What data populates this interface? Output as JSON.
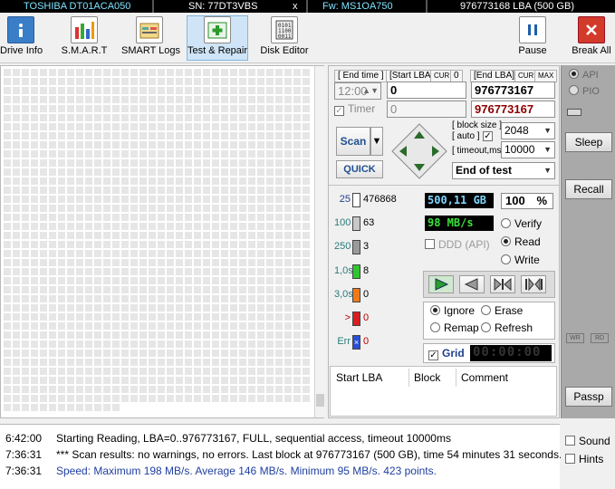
{
  "drive_bar": {
    "model": "TOSHIBA DT01ACA050",
    "serial": "SN: 77DT3VBS",
    "close": "x",
    "firmware": "Fw: MS1OA750",
    "capacity": "976773168 LBA (500 GB)"
  },
  "toolbar": {
    "items": [
      {
        "label": "Drive Info",
        "icon": "info-icon"
      },
      {
        "label": "S.M.A.R.T",
        "icon": "smart-bars-icon"
      },
      {
        "label": "SMART Logs",
        "icon": "logs-icon"
      },
      {
        "label": "Test & Repair",
        "icon": "test-repair-icon"
      },
      {
        "label": "Disk Editor",
        "icon": "disk-editor-icon"
      }
    ],
    "pause_label": "Pause",
    "break_label": "Break All",
    "colors": {
      "accent": "#1e5fa8",
      "break": "#d23a2a"
    }
  },
  "range": {
    "end_time_label": "[ End time ]",
    "start_lba_label": "[Start LBA]",
    "cur_label": "CUR",
    "start_cur_value": "0",
    "end_lba_label": "[End LBA]",
    "max_label": "MAX",
    "end_time_value": "12:00",
    "start_lba_value": "0",
    "end_lba_value": "976773167",
    "timer_label": "Timer",
    "timer_value": "0",
    "end_lba_current": "976773167"
  },
  "scan": {
    "scan_label": "Scan",
    "quick_label": "QUICK",
    "block_size_label": "[ block size ]",
    "auto_label": "[ auto ]",
    "block_size_value": "2048",
    "timeout_label": "[ timeout,ms ]",
    "timeout_value": "10000",
    "end_action": "End of test"
  },
  "legend": [
    {
      "threshold": "25",
      "count": "476868",
      "color": "#ffffff"
    },
    {
      "threshold": "100",
      "count": "63",
      "color": "#c8c8c8"
    },
    {
      "threshold": "250",
      "count": "3",
      "color": "#9a9a9a"
    },
    {
      "threshold": "1,0s",
      "count": "8",
      "color": "#2fc62f"
    },
    {
      "threshold": "3,0s",
      "count": "0",
      "color": "#f07a1a"
    },
    {
      "threshold": ">",
      "count": "0",
      "color": "#d81e1e"
    },
    {
      "threshold": "Err",
      "count": "0",
      "color": "#2a4fd6"
    }
  ],
  "stats": {
    "size": "500,11 GB",
    "percent": "100",
    "percent_sign": "%",
    "speed": "98 MB/s",
    "ddd_label": "DDD (API)",
    "modes": [
      "Verify",
      "Read",
      "Write"
    ],
    "selected_mode": "Read",
    "progress": 1.0
  },
  "actions": {
    "modes": [
      "Ignore",
      "Erase",
      "Remap",
      "Refresh"
    ],
    "selected": "Ignore",
    "grid_label": "Grid",
    "grid_checked": true,
    "timer": "00:00:00"
  },
  "side": {
    "api_label": "API",
    "pio_label": "PIO",
    "sleep_label": "Sleep",
    "recall_label": "Recall",
    "wr_label": "WR",
    "rd_label": "RD",
    "passp_label": "Passp"
  },
  "table": {
    "columns": [
      "Start LBA",
      "Block",
      "Comment"
    ]
  },
  "log": [
    {
      "time": "6:42:00",
      "text": "Starting Reading, LBA=0..976773167, FULL, sequential access, timeout 10000ms",
      "color": "#000000"
    },
    {
      "time": "7:36:31",
      "text": "*** Scan results: no warnings, no errors. Last block at 976773167 (500 GB), time 54 minutes 31 seconds.",
      "color": "#000000"
    },
    {
      "time": "7:36:31",
      "text": "Speed: Maximum 198 MB/s. Average 146 MB/s. Minimum 95 MB/s. 423 points.",
      "color": "#1f3fa0"
    }
  ],
  "log_side": {
    "sound_label": "Sound",
    "hints_label": "Hints"
  }
}
